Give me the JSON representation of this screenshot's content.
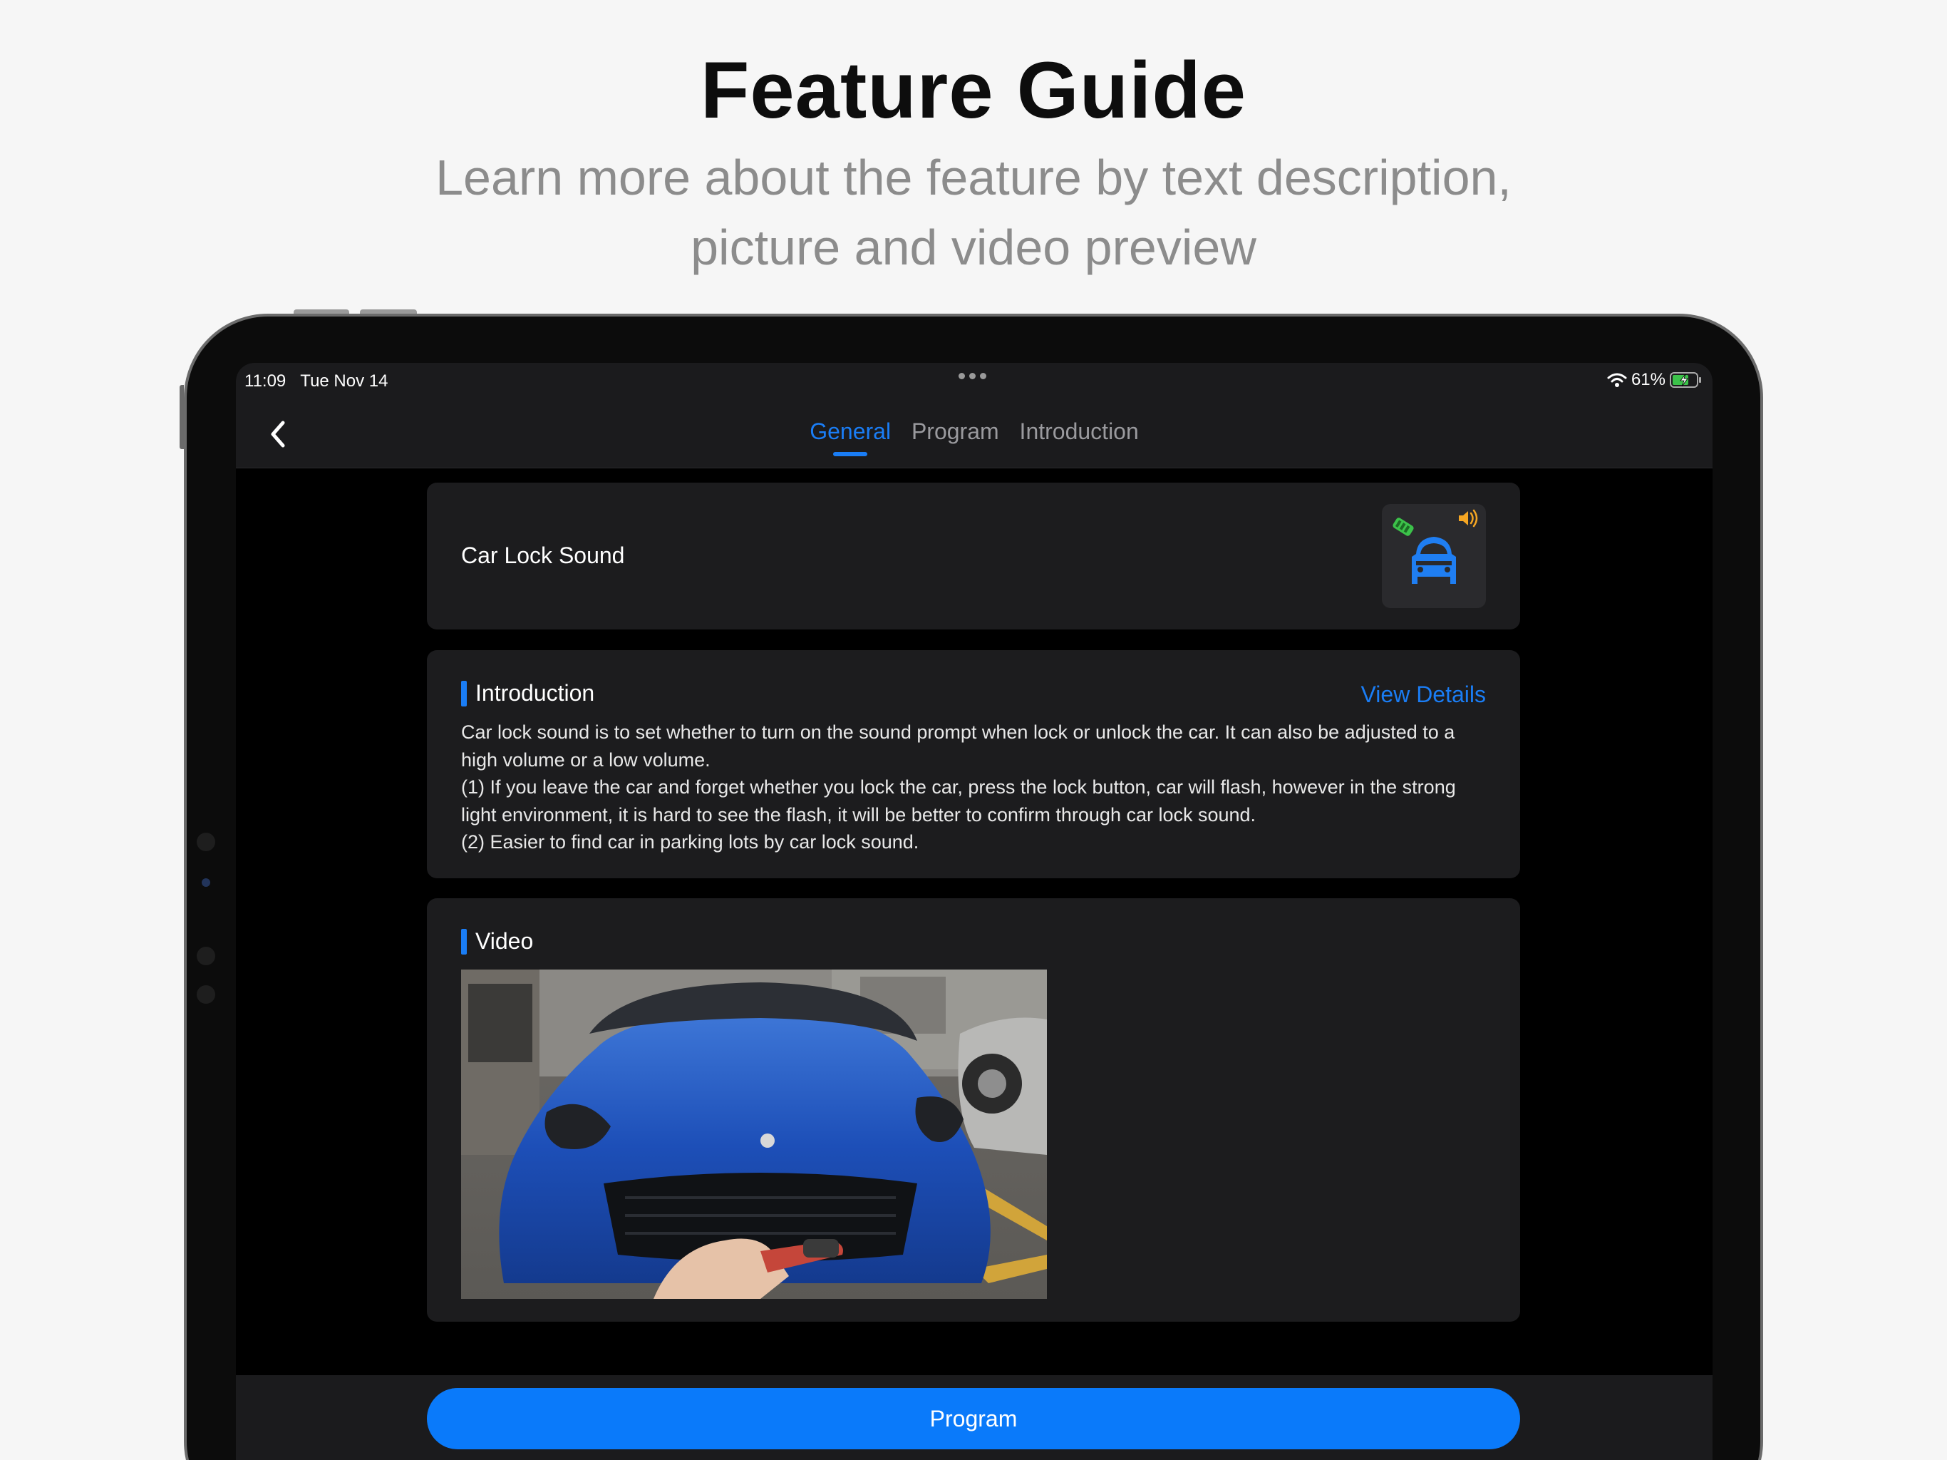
{
  "hero": {
    "title": "Feature Guide",
    "subtitle_line1": "Learn more about the feature by text description,",
    "subtitle_line2": "picture and video preview"
  },
  "status_bar": {
    "time": "11:09",
    "date": "Tue Nov 14",
    "battery": "61%"
  },
  "nav": {
    "tabs": [
      {
        "label": "General",
        "active": true
      },
      {
        "label": "Program",
        "active": false
      },
      {
        "label": "Introduction",
        "active": false
      }
    ]
  },
  "feature": {
    "name": "Car Lock Sound"
  },
  "introduction": {
    "title": "Introduction",
    "view_details": "View Details",
    "paragraphs": [
      "Car lock sound is to set whether to turn on the sound prompt when lock or unlock the car. It can also be adjusted to a high volume or a low volume.",
      "(1) If you leave the car and forget whether you lock the car, press the lock button, car will flash, however in the strong light environment, it is hard to see the flash, it will be better to confirm through car lock sound.",
      "(2) Easier to find car in parking lots by car lock sound."
    ]
  },
  "video_section": {
    "title": "Video"
  },
  "footer": {
    "program_label": "Program"
  },
  "colors": {
    "accent": "#1a7df5",
    "card": "#1c1c1e",
    "background": "#000000",
    "thumb_green": "#3cc24a",
    "thumb_orange": "#f5a623"
  }
}
